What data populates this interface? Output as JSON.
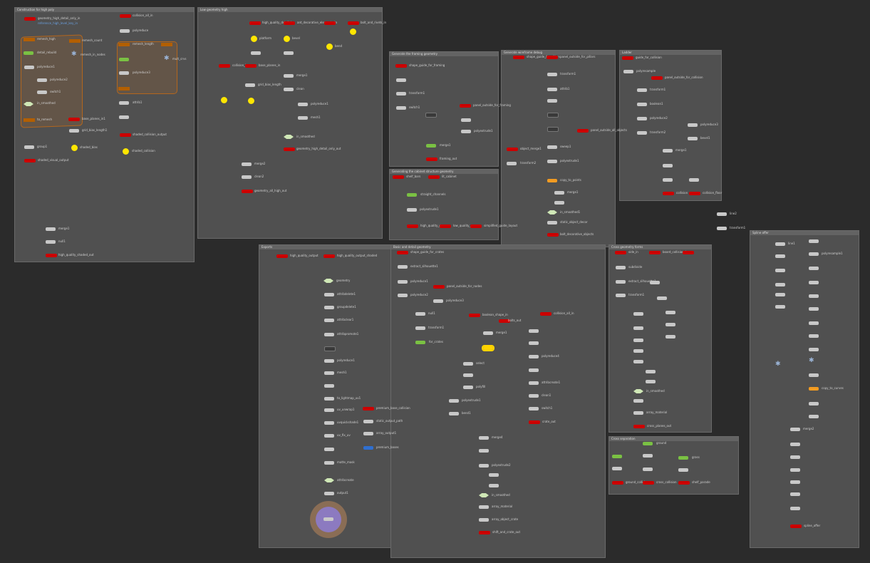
{
  "netboxes": [
    {
      "title": "Construction for high poly"
    },
    {
      "title": "Low geometry high"
    },
    {
      "title": "Generate the framing geometry"
    },
    {
      "title": "Generate wireframe debug"
    },
    {
      "title": "Ladder"
    },
    {
      "title": "Generating the cabinet structure geometry"
    },
    {
      "title": "Exports"
    },
    {
      "title": "Basic and detail geometry"
    },
    {
      "title": "Cross geometry forms"
    },
    {
      "title": "Spline offer"
    },
    {
      "title": "Cross separation"
    }
  ],
  "nodes": {
    "b1_a": "geometry_high_detail_only_in",
    "b1_b": "reference_high_level_key_in",
    "b1_c": "remesh_high",
    "b1_d": "remesh_count",
    "b1_e": "remesh_in_nodes",
    "b1_f": "to_remesh",
    "b1_g": "detail_rebuild",
    "b1_h": "polyreduce1",
    "b1_i": "polyreduce2",
    "b1_j": "null1",
    "b1_k": "switch1",
    "b1_l": "in_smoothed",
    "b1_m": "remesh_null",
    "b1_n": "shaded_visual_output",
    "b1_o": "group1",
    "b1_p": "base_planes_in1",
    "b1_q": "grid_bias_length1",
    "b1_r": "shaded_bias",
    "b1_s": "collision_all_in",
    "b1_t": "polyreduce",
    "b1_u": "remesh_length",
    "b1_v": "mult_crvs",
    "b1_w": "polyreduce3",
    "b1_x": "attrib1",
    "b1_y": "shaded_collision_output",
    "b1_z": "shaded_collision",
    "b1_aa": "merge1",
    "b1_ab": "null1",
    "b1_ac": "high_quality_shaded_out",
    "b2_a": "high_quality_detail_in",
    "b2_b": "ant_decorative_elements_in",
    "b2_c": "bolt_and_rivets_in",
    "b2_d": "platform",
    "b2_e": "bevel",
    "b2_f": "bend",
    "b2_g": "merge1",
    "b2_h": "collision_in",
    "b2_i": "base_planes_in",
    "b2_j": "grid_bias_length",
    "b2_k": "clean",
    "b2_l": "polyreduce1",
    "b2_m": "mesh1",
    "b2_n": "polybevel",
    "b2_o": "in_smoothed",
    "b2_p": "geometry_high_detail_only_out",
    "b2_q": "merge2",
    "b2_r": "clean2",
    "b2_s": "geometry_all_high_out",
    "b3_a": "shape_guide_for_framing",
    "b3_b": "transform1",
    "b3_c": "null1",
    "b3_d": "switch1",
    "b3_e": "panel_outside_for_framing",
    "b3_f": "merge1",
    "b3_g": "polyextrude1",
    "b3_h": "framing_out",
    "b4_a": "shape_guide_for_pillars",
    "b4_b": "panel_outside_for_pillars",
    "b4_c": "transform1",
    "b4_d": "attrib1",
    "b4_e": "carve1",
    "b4_f": "pillar_panel",
    "b4_g": "object_merge1",
    "b4_h": "transform2",
    "b4_i": "sweep1",
    "b4_j": "polyextrude1",
    "b4_k": "copy_to_points",
    "b4_l": "merge1",
    "b4_m": "in_smoothed1",
    "b4_n": "shaded_out",
    "b4_o": "static_object_decor",
    "b4_p": "panel_outside_all_objects",
    "b4_q": "bolt_decorative_objects",
    "b5_a": "guide_for_collision",
    "b5_b": "polyresample",
    "b5_c": "panel_outside_for_collision",
    "b5_d": "transform1",
    "b5_e": "boolean1",
    "b5_f": "polyreduce2",
    "b5_g": "transform2",
    "b5_h": "polyreduce3",
    "b5_i": "bevel1",
    "b5_j": "merge1",
    "b5_k": "collision",
    "b5_l": "collision_floor",
    "b6_a": "shelf_bars",
    "b6_b": "lit_cabinet",
    "b6_c": "straight_channels",
    "b6_d": "polyextrude1",
    "b6_e": "high_quality_geo",
    "b6_f": "low_quality_geo",
    "b6_g": "simplified_guide_layout",
    "b7_a": "high_quality_output",
    "b7_b": "high_quality_output_shaded",
    "b7_c": "geometry",
    "b7_d": "attribdelete1",
    "b7_e": "groupdelete1",
    "b7_f": "attribclear1",
    "b7_g": "attribpromote1",
    "b7_h": "null_points",
    "b7_i": "polyreduce1",
    "b7_j": "mesh1",
    "b7_k": "to_lightmap_uv1",
    "b7_l": "uv_unwrap1",
    "b7_m": "uvquickshade1",
    "b7_n": "uv_fix_uv",
    "b7_o": "premium_base_collision",
    "b7_p": "static_output_path",
    "b7_q": "array_output1",
    "b7_r": "premium_bases",
    "b7_s": "matte_mask",
    "b7_t": "attribcreate",
    "b7_u": "null",
    "b7_v": "output1",
    "b8_a": "shape_guide_for_crates",
    "b8_b": "extract_silhouette1",
    "b8_c": "polyreduce1",
    "b8_d": "panel_outside_for_nodes",
    "b8_e": "polyreduce2",
    "b8_f": "polyreduce3",
    "b8_g": "null1",
    "b8_h": "transform1",
    "b8_i": "for_crates",
    "b8_j": "boolean_shape_in",
    "b8_k": "bolts_out",
    "b8_l": "collision_all_in",
    "b8_m": "merge1",
    "b8_n": "select",
    "b8_o": "merge2",
    "b8_p": "polyfill",
    "b8_q": "polyextrude1",
    "b8_r": "polybevel",
    "b8_s": "detail1",
    "b8_t": "polyreduce4",
    "b8_u": "bend1",
    "b8_v": "merge3",
    "b8_w": "attribcreate1",
    "b8_x": "clean1",
    "b8_y": "switch1",
    "b8_z": "crate_out",
    "b8_aa": "merge4",
    "b8_ab": "polyextrude2",
    "b8_ac": "in_smoothed",
    "b8_ad": "array_material",
    "b8_ae": "array_object_crate",
    "b8_af": "shift_and_crate_out",
    "b9_a": "side_in",
    "b9_b": "board_collision_in",
    "b9_c": "subdivide",
    "b9_d": "transform1",
    "b9_e": "extract_silhouette1",
    "b9_f": "polybevel1",
    "b9_g": "transform2",
    "b9_h": "sweep",
    "b9_i": "polyextrude",
    "b9_j": "merge1",
    "b9_k": "array_material",
    "b9_l": "in_smoothed",
    "b9_m": "cross_planes_out",
    "b10_a": "line1",
    "b10_b": "polyresample1",
    "b10_c": "null2",
    "b10_d": "attrib3",
    "b10_e": "polyframe1",
    "b10_f": "copy_to_curves",
    "b10_g": "sweep3",
    "b10_h": "transform2",
    "b10_i": "array_material",
    "b10_j": "merge2",
    "b10_k": "spline_offer",
    "b11_a": "ground",
    "b11_b": "ground_collision",
    "b11_c": "cross_collision",
    "b11_d": "grass",
    "b11_e": "shelf_parade",
    "free_a": "line2",
    "free_b": "transform1"
  }
}
